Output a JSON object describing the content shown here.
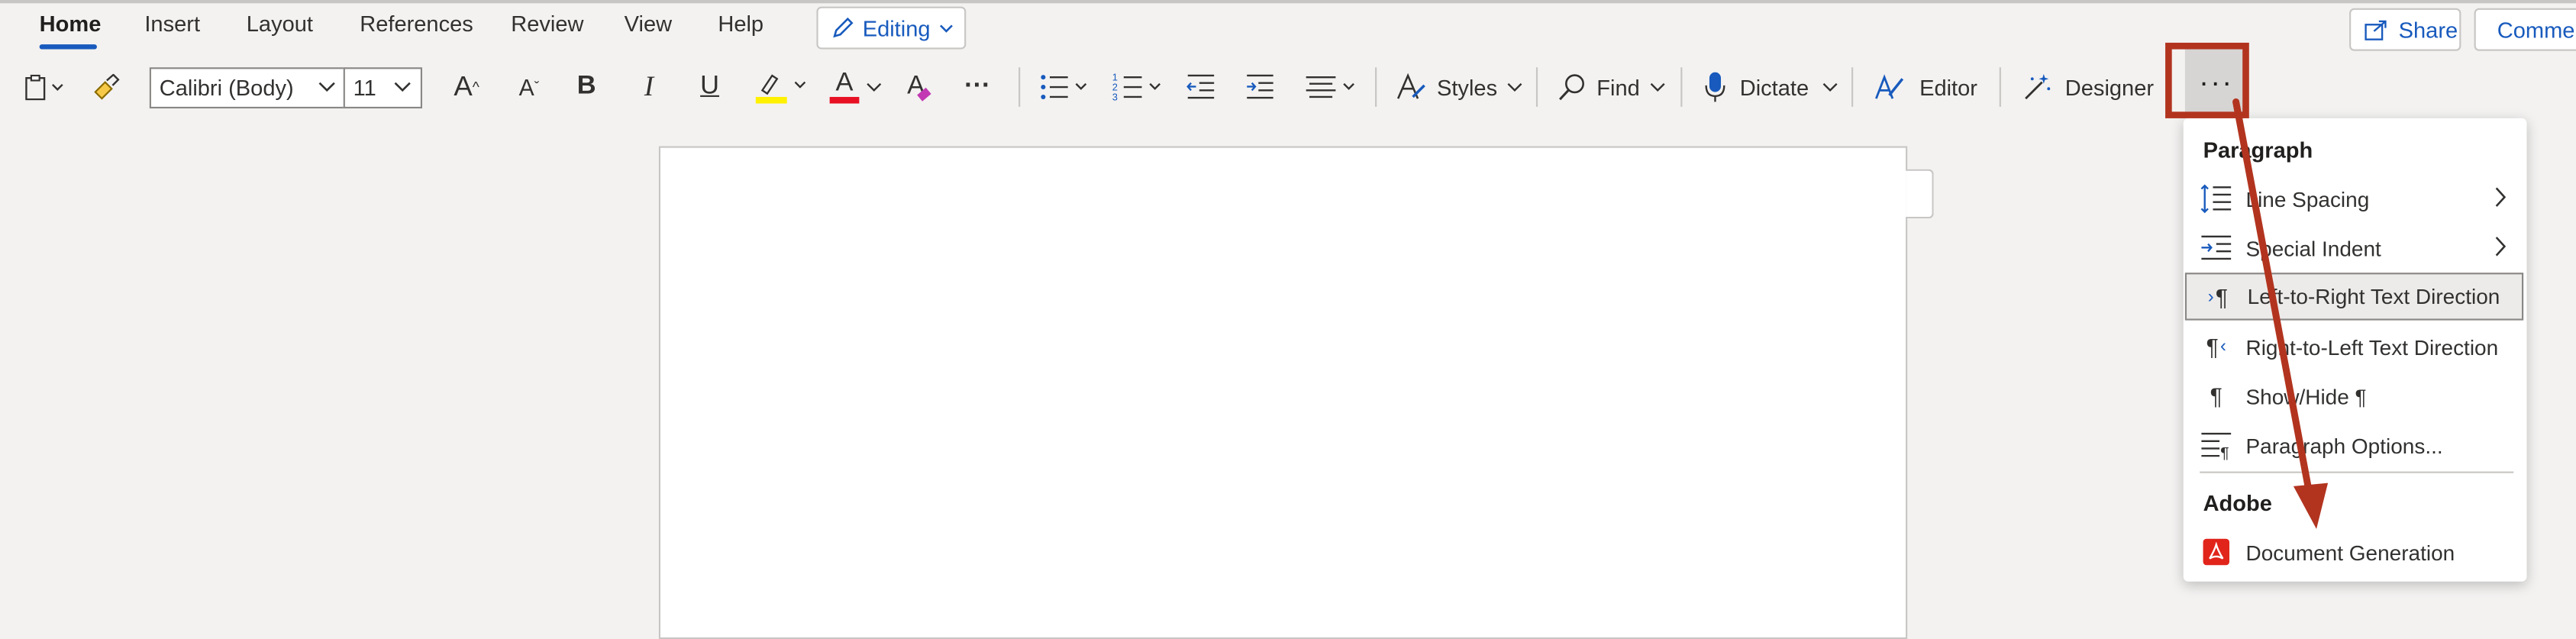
{
  "tabs": [
    {
      "label": "Home",
      "active": true
    },
    {
      "label": "Insert"
    },
    {
      "label": "Layout"
    },
    {
      "label": "References"
    },
    {
      "label": "Review"
    },
    {
      "label": "View"
    },
    {
      "label": "Help"
    }
  ],
  "mode": {
    "label": "Editing",
    "icon": "pencil-icon"
  },
  "header_actions": {
    "share": "Share",
    "comments": "Comments"
  },
  "ribbon": {
    "font_name": "Calibri (Body)",
    "font_size": "11",
    "grow_font": "A",
    "shrink_font": "A",
    "bold": "B",
    "italic": "I",
    "underline": "U",
    "font_color": "A",
    "clear_format": "A",
    "more": "···",
    "styles": "Styles",
    "find": "Find",
    "dictate": "Dictate",
    "editor": "Editor",
    "designer": "Designer",
    "overflow": "···"
  },
  "menu": {
    "section_paragraph": "Paragraph",
    "items": [
      {
        "label": "Line Spacing",
        "icon": "line-spacing-icon",
        "submenu": true
      },
      {
        "label": "Special Indent",
        "icon": "special-indent-icon",
        "submenu": true
      },
      {
        "label": "Left-to-Right Text Direction",
        "icon": "ltr-direction-icon",
        "selected": true
      },
      {
        "label": "Right-to-Left Text Direction",
        "icon": "rtl-direction-icon"
      },
      {
        "label": "Show/Hide ¶",
        "icon": "pilcrow-icon"
      },
      {
        "label": "Paragraph Options...",
        "icon": "paragraph-options-icon"
      }
    ],
    "section_adobe": "Adobe",
    "adobe_item": {
      "label": "Document Generation",
      "icon": "adobe-pdf-icon"
    }
  },
  "colors": {
    "accent": "#185abd",
    "highlight": "#fff100",
    "font_color_bar": "#e81123",
    "annotation": "#b2341f",
    "adobe": "#e1251b"
  }
}
